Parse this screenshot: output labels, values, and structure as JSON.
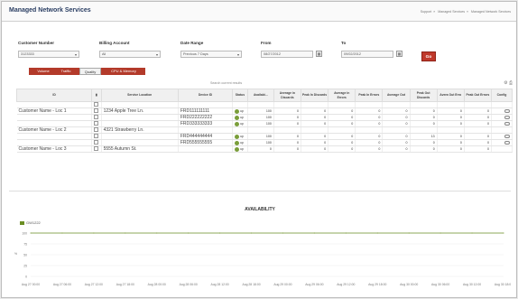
{
  "app": {
    "title": "Managed Network Services",
    "breadcrumbs": [
      "Support",
      "Managed Services",
      "Managed Network Services"
    ]
  },
  "filters": {
    "customer_number_label": "Customer Number",
    "customer_number_value": "3123333",
    "billing_account_label": "Billing Account",
    "billing_account_value": "All",
    "date_range_label": "Date Range",
    "date_range_value": "Previous 7 Days",
    "from_label": "From",
    "from_value": "08/27/2012",
    "to_label": "To",
    "to_value": "09/02/2012",
    "go_label": "Go"
  },
  "tabs": [
    "Volume",
    "Traffic",
    "Quality",
    "CPU & Memory"
  ],
  "active_tab": "Quality",
  "table": {
    "search_hint": "Search current results",
    "headers": [
      "ID",
      "",
      "Service Location",
      "Device ID",
      "Status",
      "Availabi...",
      "Average in Discards",
      "Peak In Discards",
      "Average in Errors",
      "Peak In Errors",
      "Average Out",
      "Peak Out Discards",
      "Avera Out Erro",
      "Peak Out Errors",
      "Config"
    ],
    "rows": [
      {
        "customer": "",
        "location": "",
        "device": "",
        "status": "",
        "avail": "",
        "v": [
          "",
          "",
          "",
          "",
          "",
          "",
          "",
          ""
        ]
      },
      {
        "customer": "Customer Name - Loc 1",
        "location": "1234 Apple Tree Ln.",
        "device": "FRD111111111",
        "status": "up",
        "avail": "100",
        "v": [
          "0",
          "0",
          "0",
          "0",
          "0",
          "0",
          "0",
          "0"
        ]
      },
      {
        "customer": "",
        "location": "",
        "device": "FRD222222222",
        "status": "up",
        "avail": "100",
        "v": [
          "0",
          "0",
          "0",
          "0",
          "0",
          "0",
          "0",
          "0"
        ]
      },
      {
        "customer": "",
        "location": "",
        "device": "FRD333333333",
        "status": "up",
        "avail": "100",
        "v": [
          "0",
          "0",
          "0",
          "0",
          "0",
          "0",
          "0",
          "0"
        ]
      },
      {
        "customer": "Customer Name - Loc 2",
        "location": "4321 Strawberry Ln.",
        "device": "",
        "status": "",
        "avail": "",
        "v": [
          "",
          "",
          "",
          "",
          "",
          "",
          "",
          ""
        ]
      },
      {
        "customer": "",
        "location": "",
        "device": "FRD444444444",
        "status": "up",
        "avail": "100",
        "v": [
          "0",
          "0",
          "0",
          "0",
          "0",
          "13",
          "0",
          "0"
        ]
      },
      {
        "customer": "",
        "location": "",
        "device": "FRD555555555",
        "status": "up",
        "avail": "100",
        "v": [
          "0",
          "0",
          "0",
          "0",
          "0",
          "0",
          "0",
          "0"
        ]
      },
      {
        "customer": "Customer Name - Loc 3",
        "location": "5555 Autumn St.",
        "device": "",
        "status": "up",
        "avail": "0",
        "v": [
          "0",
          "0",
          "0",
          "0",
          "0",
          "0",
          "0",
          "0"
        ]
      }
    ]
  },
  "chart_data": {
    "type": "line",
    "title": "AVAILABILITY",
    "series": [
      {
        "name": "GW1222",
        "values": [
          100,
          100,
          100,
          100,
          100,
          100,
          100,
          100,
          100,
          100,
          100,
          100,
          100,
          100,
          100,
          100
        ]
      }
    ],
    "x": [
      "Aug 27 00:00",
      "Aug 27 06:00",
      "Aug 27 12:00",
      "Aug 27 18:00",
      "Aug 28 00:00",
      "Aug 28 06:00",
      "Aug 28 12:00",
      "Aug 28 18:00",
      "Aug 29 00:00",
      "Aug 29 06:00",
      "Aug 29 12:00",
      "Aug 29 18:00",
      "Aug 30 00:00",
      "Aug 30 06:00",
      "Aug 30 12:00",
      "Aug 30 18:00"
    ],
    "yticks": [
      "100",
      "75",
      "50",
      "25",
      "0"
    ],
    "ylabel": "%",
    "ylim": [
      0,
      100
    ],
    "grid": true,
    "legend": "top-left",
    "color": "#6b8e23"
  }
}
